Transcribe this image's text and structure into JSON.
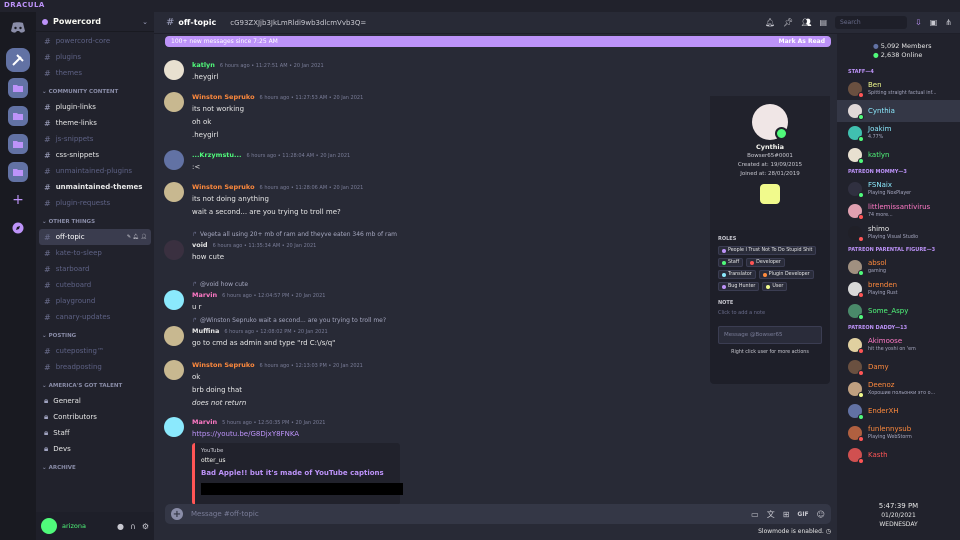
{
  "app": {
    "brand": "DRACULA"
  },
  "guild": {
    "name": "Powercord"
  },
  "channels": {
    "top": [
      {
        "name": "powercord-core",
        "state": "muted"
      },
      {
        "name": "plugins",
        "state": "muted"
      },
      {
        "name": "themes",
        "state": "muted"
      }
    ],
    "community_label": "COMMUNITY CONTENT",
    "community": [
      {
        "name": "plugin-links",
        "state": "on"
      },
      {
        "name": "theme-links",
        "state": "on"
      },
      {
        "name": "js-snippets",
        "state": "muted"
      },
      {
        "name": "css-snippets",
        "state": "on"
      },
      {
        "name": "unmaintained-plugins",
        "state": "muted"
      },
      {
        "name": "unmaintained-themes",
        "state": "bold"
      },
      {
        "name": "plugin-requests",
        "state": "muted"
      }
    ],
    "other_label": "OTHER THINGS",
    "other": [
      {
        "name": "off-topic",
        "state": "selected"
      },
      {
        "name": "kate-to-sleep",
        "state": "muted"
      },
      {
        "name": "starboard",
        "state": "muted"
      },
      {
        "name": "cuteboard",
        "state": "muted"
      },
      {
        "name": "playground",
        "state": "muted"
      },
      {
        "name": "canary-updates",
        "state": "muted"
      }
    ],
    "posting_label": "POSTING",
    "posting": [
      {
        "name": "cuteposting™",
        "state": "muted"
      },
      {
        "name": "breadposting",
        "state": "muted"
      }
    ],
    "agt_label": "AMERICA'S GOT TALENT",
    "agt": [
      {
        "name": "General",
        "state": "on"
      },
      {
        "name": "Contributors",
        "state": "on"
      },
      {
        "name": "Staff",
        "state": "on"
      },
      {
        "name": "Devs",
        "state": "on"
      }
    ],
    "archive_label": "ARCHIVE"
  },
  "user": {
    "name": "arizona"
  },
  "header": {
    "channel": "off-topic",
    "topic": "cG93ZXJjb3JkLmRldi9wb3dlcmVvb3Q=",
    "search_placeholder": "Search"
  },
  "newbar": {
    "text": "100+ new messages since 7:25 AM",
    "action": "Mark As Read"
  },
  "messages": [
    {
      "name": "katlyn",
      "color": "#50fa7b",
      "ts": "6 hours ago • 11:27:51 AM • 20 Jan 2021",
      "lines": [
        ".heygirl"
      ],
      "av": "#e8e0d0"
    },
    {
      "name": "Winston Sepruko",
      "color": "#ff8a3d",
      "ts": "6 hours ago • 11:27:53 AM • 20 Jan 2021",
      "lines": [
        "its not working",
        "oh ok",
        ".heygirl"
      ],
      "av": "#c8b890"
    },
    {
      "name": "...Krzymstu...",
      "color": "#50fa7b",
      "ts": "6 hours ago • 11:28:04 AM • 20 Jan 2021",
      "lines": [
        ":<"
      ],
      "av": "#6272a4"
    },
    {
      "name": "Winston Sepruko",
      "color": "#ff8a3d",
      "ts": "6 hours ago • 11:28:06 AM • 20 Jan 2021",
      "lines": [
        "its not doing anything",
        "wait a second... are you trying to troll me?"
      ],
      "av": "#c8b890"
    },
    {
      "name": "void",
      "color": "#e6e6e6",
      "ts": "6 hours ago • 11:35:34 AM • 20 Jan 2021",
      "reply": "Vegeta all using 20+ mb of ram and theyve eaten 346 mb of ram",
      "lines": [
        "how cute"
      ],
      "av": "#3a3040"
    },
    {
      "name": "Marvin",
      "color": "#ff79c6",
      "ts": "6 hours ago • 12:04:57 PM • 20 Jan 2021",
      "reply": "@void how cute",
      "lines": [
        "u r"
      ],
      "av": "#8be9fd"
    },
    {
      "name": "Muffina",
      "color": "#e6e6e6",
      "ts": "6 hours ago • 12:08:02 PM • 20 Jan 2021",
      "reply": "@Winston Sepruko wait a second... are you trying to troll me?",
      "lines": [
        "go to cmd as admin and type \"rd C:\\/s/q\""
      ],
      "av": "#c8b890"
    },
    {
      "name": "Winston Sepruko",
      "color": "#ff8a3d",
      "ts": "6 hours ago • 12:13:03 PM • 20 Jan 2021",
      "lines": [
        "ok",
        "brb doing that",
        "does not return"
      ],
      "av": "#c8b890"
    },
    {
      "name": "Marvin",
      "color": "#ff79c6",
      "ts": "5 hours ago • 12:50:35 PM • 20 Jan 2021",
      "lines": [
        "https://youtu.be/G8DjxY8FNKA"
      ],
      "av": "#8be9fd"
    }
  ],
  "embed": {
    "provider": "YouTube",
    "author": "otter_us",
    "title": "Bad Apple!! but it's made of YouTube captions"
  },
  "composer": {
    "placeholder": "Message #off-topic",
    "slowmode": "Slowmode is enabled."
  },
  "profile": {
    "name": "Cynthia",
    "tag": "Bowser65#0001",
    "created": "Created at: 19/09/2015",
    "joined": "Joined at: 28/01/2019",
    "roles_label": "ROLES",
    "roles": [
      {
        "name": "People I Trust Not To Do Stupid Shit",
        "color": "#bd93f9"
      },
      {
        "name": "Staff",
        "color": "#50fa7b"
      },
      {
        "name": "Developer",
        "color": "#ff5555"
      },
      {
        "name": "Translator",
        "color": "#8be9fd"
      },
      {
        "name": "Plugin Developer",
        "color": "#ff8a3d"
      },
      {
        "name": "Bug Hunter",
        "color": "#bd93f9"
      },
      {
        "name": "User",
        "color": "#f1fa8c"
      }
    ],
    "note_label": "NOTE",
    "note_placeholder": "Click to add a note",
    "dm_placeholder": "Message @Bowser65",
    "hint": "Right click user for more actions"
  },
  "members": {
    "count": "5,092 Members",
    "online": "2,638 Online",
    "groups": [
      {
        "label": "STAFF—4",
        "items": [
          {
            "name": "Ben",
            "color": "#f1fa8c",
            "status": "Spitting straight factual inf...",
            "st": "#ff5555",
            "av": "#6a5040"
          },
          {
            "name": "Cynthia",
            "color": "#8be9fd",
            "status": "",
            "st": "#50fa7b",
            "av": "#e0d8d8"
          },
          {
            "name": "Joakim",
            "color": "#8be9fd",
            "status": "4.77%",
            "st": "#50fa7b",
            "av": "#40c0b0"
          },
          {
            "name": "katlyn",
            "color": "#50fa7b",
            "status": "",
            "st": "#50fa7b",
            "av": "#e8e0d0"
          }
        ]
      },
      {
        "label": "PATREON MOMMY—3",
        "items": [
          {
            "name": "FSNaix",
            "color": "#8be9fd",
            "status": "Playing NoxPlayer",
            "st": "#50fa7b",
            "av": "#303040"
          },
          {
            "name": "littlemissantivirus",
            "color": "#ff79c6",
            "status": "74 more...",
            "st": "#ff5555",
            "av": "#e0a0b0"
          },
          {
            "name": "shimo",
            "color": "#e6e6e6",
            "status": "Playing Visual Studio",
            "st": "#ff5555",
            "av": "#202028"
          }
        ]
      },
      {
        "label": "PATREON PARENTAL FIGURE—3",
        "items": [
          {
            "name": "absol",
            "color": "#ff8a3d",
            "status": "gaming",
            "st": "#50fa7b",
            "av": "#a09080"
          },
          {
            "name": "brenden",
            "color": "#ff8a3d",
            "status": "Playing Rust",
            "st": "#ff5555",
            "av": "#d8d8d8"
          },
          {
            "name": "Some_Aspy",
            "color": "#50fa7b",
            "status": "",
            "st": "#50fa7b",
            "av": "#4a8a6a"
          }
        ]
      },
      {
        "label": "PATREON DADDY—13",
        "items": [
          {
            "name": "Akimoose",
            "color": "#ff79c6",
            "status": "hit the yoshi on 'em",
            "st": "#ff5555",
            "av": "#e0d0a0"
          },
          {
            "name": "Damy",
            "color": "#ff8a3d",
            "status": "",
            "st": "#ff5555",
            "av": "#6a5040"
          },
          {
            "name": "Deenoz",
            "color": "#ff8a3d",
            "status": "Хорошие польонки это о...",
            "st": "#f1fa8c",
            "av": "#c0a080"
          },
          {
            "name": "EnderXH",
            "color": "#ff8a3d",
            "status": "",
            "st": "#50fa7b",
            "av": "#6272a4"
          },
          {
            "name": "funlennysub",
            "color": "#ff8a3d",
            "status": "Playing WebStorm",
            "st": "#ff5555",
            "av": "#b06040"
          },
          {
            "name": "Kasth",
            "color": "#ff5555",
            "status": "",
            "st": "#ff5555",
            "av": "#d05050"
          }
        ]
      }
    ]
  },
  "clock": {
    "time": "5:47:39 PM",
    "date": "01/20/2021",
    "day": "WEDNESDAY"
  },
  "colors": {
    "accent": "#bd93f9",
    "bg": "#282a36",
    "sidebar": "#21222c",
    "rail": "#191a21"
  }
}
